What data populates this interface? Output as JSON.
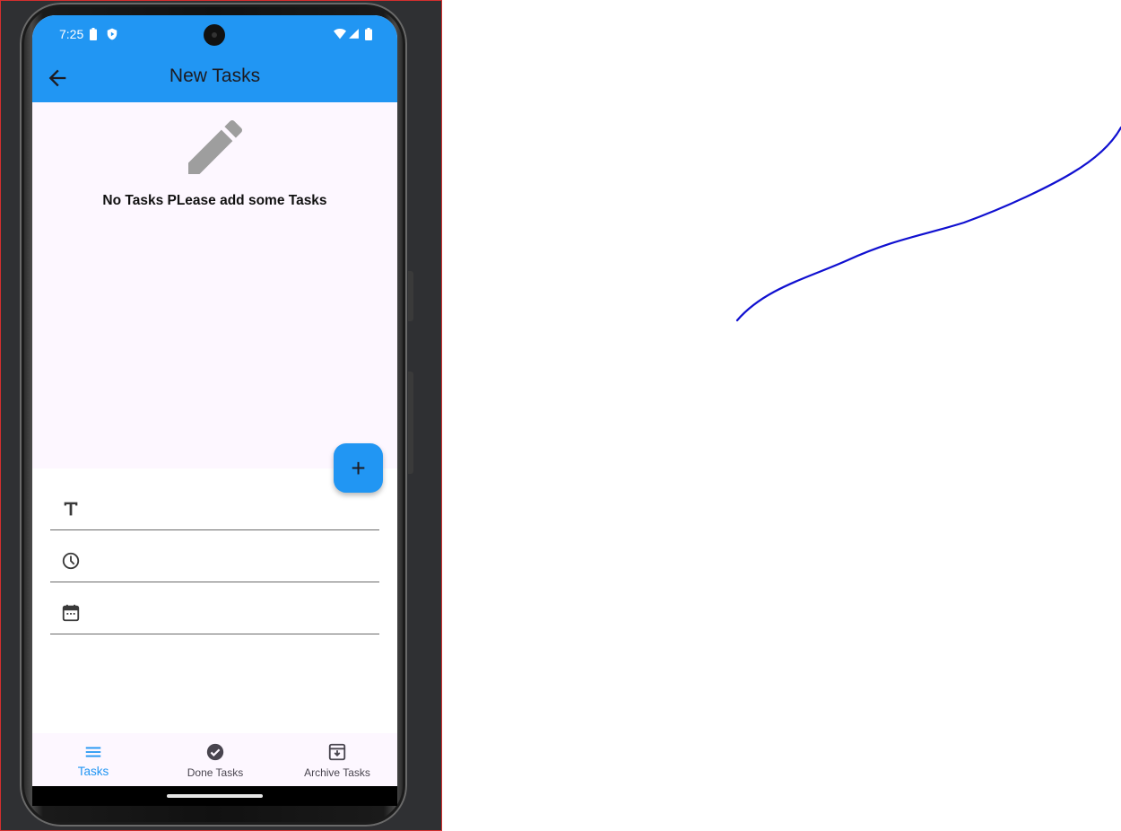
{
  "status_bar": {
    "time": "7:25"
  },
  "app_bar": {
    "title": "New Tasks"
  },
  "empty_state": {
    "message": "No Tasks PLease add some Tasks"
  },
  "form": {
    "title_value": "",
    "time_value": "",
    "date_value": ""
  },
  "fab": {
    "label": "+"
  },
  "bottom_nav": {
    "items": [
      {
        "label": "Tasks",
        "active": true
      },
      {
        "label": "Done Tasks",
        "active": false
      },
      {
        "label": "Archive Tasks",
        "active": false
      }
    ]
  },
  "colors": {
    "primary": "#2196f3",
    "surface": "#fdf7ff",
    "annotation_stroke": "#1010d0"
  }
}
